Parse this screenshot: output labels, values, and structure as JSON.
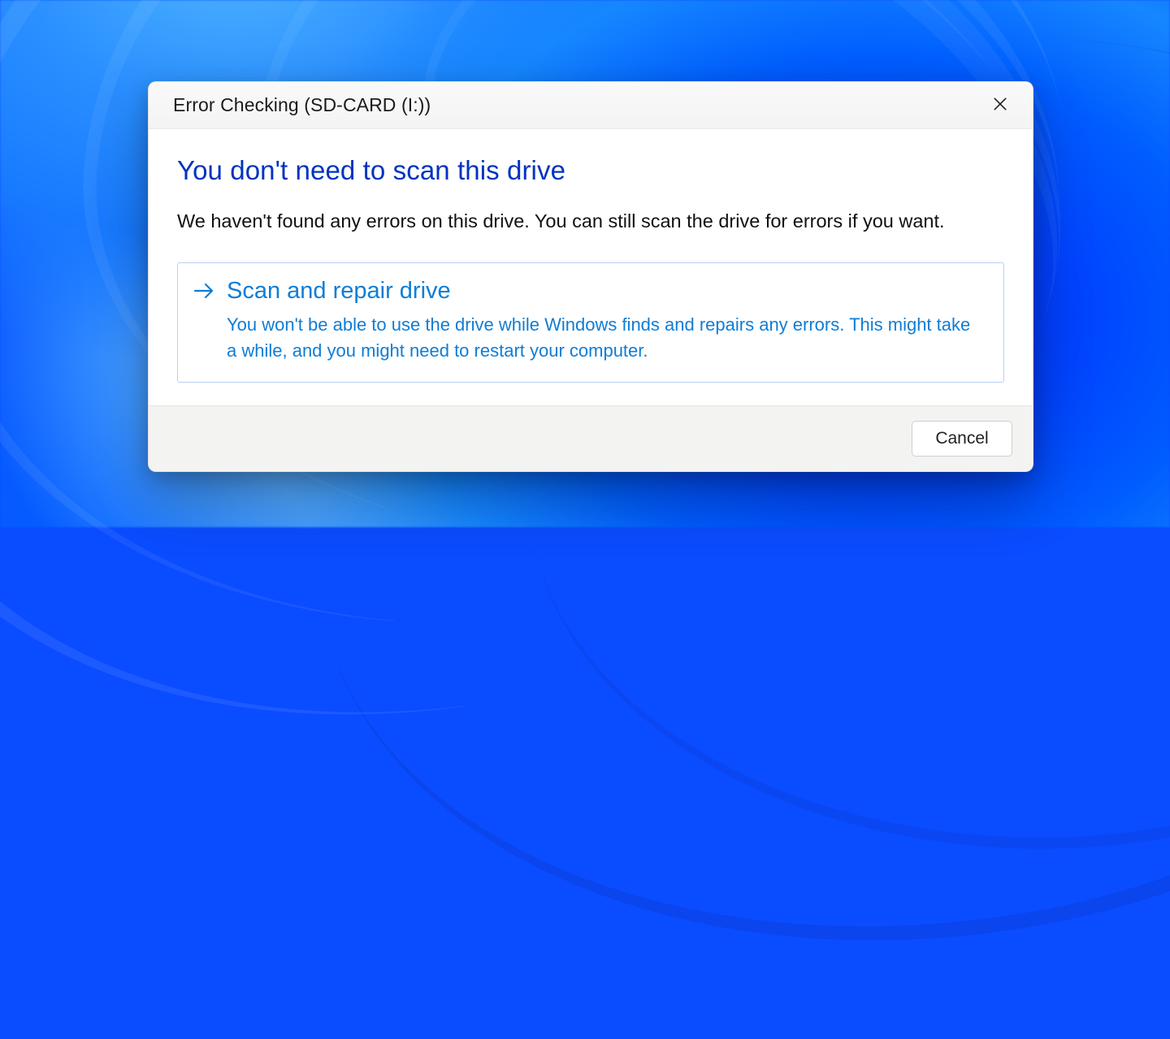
{
  "dialog": {
    "title": "Error Checking (SD-CARD (I:))",
    "headline": "You don't need to scan this drive",
    "body": "We haven't found any errors on this drive. You can still scan the drive for errors if you want.",
    "commandlink": {
      "title": "Scan and repair drive",
      "desc": "You won't be able to use the drive while Windows finds and repairs any errors. This might take a while, and you might need to restart your computer."
    },
    "buttons": {
      "cancel": "Cancel"
    }
  },
  "colors": {
    "headline_color": "#0033c0",
    "commandlink_color": "#0f7dd6"
  }
}
